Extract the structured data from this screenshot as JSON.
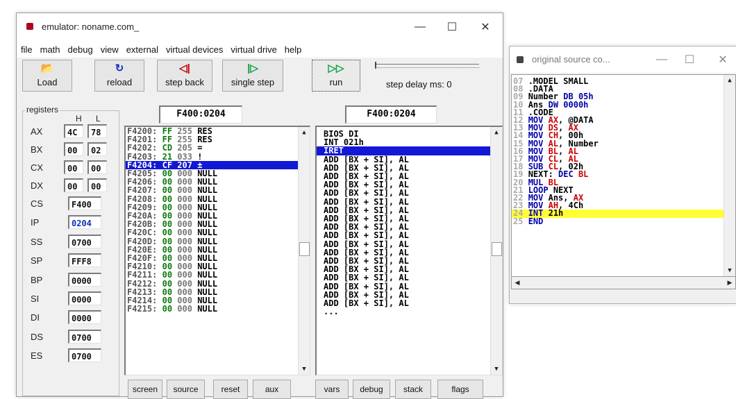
{
  "main_window": {
    "title": "emulator: noname.com_",
    "controls": {
      "minimize": "—",
      "maximize": "☐",
      "close": "✕"
    },
    "menu": [
      "file",
      "math",
      "debug",
      "view",
      "external",
      "virtual devices",
      "virtual drive",
      "help"
    ],
    "toolbar": {
      "load": "Load",
      "reload": "reload",
      "step_back": "step back",
      "single_step": "single step",
      "run": "run",
      "step_delay": "step delay ms: 0"
    },
    "registers": {
      "group_label": "registers",
      "h_header": "H",
      "l_header": "L",
      "pairs": [
        {
          "name": "AX",
          "h": "4C",
          "l": "78"
        },
        {
          "name": "BX",
          "h": "00",
          "l": "02"
        },
        {
          "name": "CX",
          "h": "00",
          "l": "00"
        },
        {
          "name": "DX",
          "h": "00",
          "l": "00"
        }
      ],
      "singles": [
        {
          "name": "CS",
          "value": "F400"
        },
        {
          "name": "IP",
          "value": "0204"
        },
        {
          "name": "SS",
          "value": "0700"
        },
        {
          "name": "SP",
          "value": "FFF8"
        },
        {
          "name": "BP",
          "value": "0000"
        },
        {
          "name": "SI",
          "value": "0000"
        },
        {
          "name": "DI",
          "value": "0000"
        },
        {
          "name": "DS",
          "value": "0700"
        },
        {
          "name": "ES",
          "value": "0700"
        }
      ]
    },
    "memory_address": "F400:0204",
    "disasm_address": "F400:0204",
    "memory_rows": [
      {
        "addr": "F4200:",
        "hex": "FF",
        "dec": "255",
        "chr": "RES"
      },
      {
        "addr": "F4201:",
        "hex": "FF",
        "dec": "255",
        "chr": "RES"
      },
      {
        "addr": "F4202:",
        "hex": "CD",
        "dec": "205",
        "chr": "="
      },
      {
        "addr": "F4203:",
        "hex": "21",
        "dec": "033",
        "chr": "!"
      },
      {
        "addr": "F4204:",
        "hex": "CF",
        "dec": "207",
        "chr": "±"
      },
      {
        "addr": "F4205:",
        "hex": "00",
        "dec": "000",
        "chr": "NULL"
      },
      {
        "addr": "F4206:",
        "hex": "00",
        "dec": "000",
        "chr": "NULL"
      },
      {
        "addr": "F4207:",
        "hex": "00",
        "dec": "000",
        "chr": "NULL"
      },
      {
        "addr": "F4208:",
        "hex": "00",
        "dec": "000",
        "chr": "NULL"
      },
      {
        "addr": "F4209:",
        "hex": "00",
        "dec": "000",
        "chr": "NULL"
      },
      {
        "addr": "F420A:",
        "hex": "00",
        "dec": "000",
        "chr": "NULL"
      },
      {
        "addr": "F420B:",
        "hex": "00",
        "dec": "000",
        "chr": "NULL"
      },
      {
        "addr": "F420C:",
        "hex": "00",
        "dec": "000",
        "chr": "NULL"
      },
      {
        "addr": "F420D:",
        "hex": "00",
        "dec": "000",
        "chr": "NULL"
      },
      {
        "addr": "F420E:",
        "hex": "00",
        "dec": "000",
        "chr": "NULL"
      },
      {
        "addr": "F420F:",
        "hex": "00",
        "dec": "000",
        "chr": "NULL"
      },
      {
        "addr": "F4210:",
        "hex": "00",
        "dec": "000",
        "chr": "NULL"
      },
      {
        "addr": "F4211:",
        "hex": "00",
        "dec": "000",
        "chr": "NULL"
      },
      {
        "addr": "F4212:",
        "hex": "00",
        "dec": "000",
        "chr": "NULL"
      },
      {
        "addr": "F4213:",
        "hex": "00",
        "dec": "000",
        "chr": "NULL"
      },
      {
        "addr": "F4214:",
        "hex": "00",
        "dec": "000",
        "chr": "NULL"
      },
      {
        "addr": "F4215:",
        "hex": "00",
        "dec": "000",
        "chr": "NULL"
      }
    ],
    "memory_selected_index": 4,
    "disasm_rows": [
      "BIOS DI",
      "INT 021h",
      "IRET",
      "ADD [BX + SI], AL",
      "ADD [BX + SI], AL",
      "ADD [BX + SI], AL",
      "ADD [BX + SI], AL",
      "ADD [BX + SI], AL",
      "ADD [BX + SI], AL",
      "ADD [BX + SI], AL",
      "ADD [BX + SI], AL",
      "ADD [BX + SI], AL",
      "ADD [BX + SI], AL",
      "ADD [BX + SI], AL",
      "ADD [BX + SI], AL",
      "ADD [BX + SI], AL",
      "ADD [BX + SI], AL",
      "ADD [BX + SI], AL",
      "ADD [BX + SI], AL",
      "ADD [BX + SI], AL",
      "ADD [BX + SI], AL",
      "..."
    ],
    "disasm_selected_index": 2,
    "bottom_buttons": [
      "screen",
      "source",
      "reset",
      "aux",
      "vars",
      "debug",
      "stack",
      "flags"
    ]
  },
  "source_window": {
    "title": "original source co...",
    "controls": {
      "minimize": "—",
      "maximize": "☐",
      "close": "✕"
    },
    "lines": [
      {
        "n": "07",
        "parts": [
          {
            "t": ".MODEL SMALL",
            "c": "tx"
          }
        ]
      },
      {
        "n": "08",
        "parts": [
          {
            "t": ".DATA",
            "c": "tx"
          }
        ]
      },
      {
        "n": "09",
        "parts": [
          {
            "t": "Number ",
            "c": "tx"
          },
          {
            "t": "DB 05h",
            "c": "kw"
          }
        ]
      },
      {
        "n": "10",
        "parts": [
          {
            "t": "Ans ",
            "c": "tx"
          },
          {
            "t": "DW 0000h",
            "c": "kw"
          }
        ]
      },
      {
        "n": "11",
        "parts": [
          {
            "t": ".CODE",
            "c": "tx"
          }
        ]
      },
      {
        "n": "12",
        "parts": [
          {
            "t": "MOV ",
            "c": "kw"
          },
          {
            "t": "AX",
            "c": "rg"
          },
          {
            "t": ", @DATA",
            "c": "tx"
          }
        ]
      },
      {
        "n": "13",
        "parts": [
          {
            "t": "MOV ",
            "c": "kw"
          },
          {
            "t": "DS",
            "c": "rg"
          },
          {
            "t": ", ",
            "c": "tx"
          },
          {
            "t": "AX",
            "c": "rg"
          }
        ]
      },
      {
        "n": "14",
        "parts": [
          {
            "t": "MOV ",
            "c": "kw"
          },
          {
            "t": "CH",
            "c": "rg"
          },
          {
            "t": ", 00h",
            "c": "tx"
          }
        ]
      },
      {
        "n": "15",
        "parts": [
          {
            "t": "MOV ",
            "c": "kw"
          },
          {
            "t": "AL",
            "c": "rg"
          },
          {
            "t": ", Number",
            "c": "tx"
          }
        ]
      },
      {
        "n": "16",
        "parts": [
          {
            "t": "MOV ",
            "c": "kw"
          },
          {
            "t": "BL",
            "c": "rg"
          },
          {
            "t": ", ",
            "c": "tx"
          },
          {
            "t": "AL",
            "c": "rg"
          }
        ]
      },
      {
        "n": "17",
        "parts": [
          {
            "t": "MOV ",
            "c": "kw"
          },
          {
            "t": "CL",
            "c": "rg"
          },
          {
            "t": ", ",
            "c": "tx"
          },
          {
            "t": "AL",
            "c": "rg"
          }
        ]
      },
      {
        "n": "18",
        "parts": [
          {
            "t": "SUB ",
            "c": "kw"
          },
          {
            "t": "CL",
            "c": "rg"
          },
          {
            "t": ", 02h",
            "c": "tx"
          }
        ]
      },
      {
        "n": "19",
        "parts": [
          {
            "t": "NEXT: ",
            "c": "tx"
          },
          {
            "t": "DEC ",
            "c": "kw"
          },
          {
            "t": "BL",
            "c": "rg"
          }
        ]
      },
      {
        "n": "20",
        "parts": [
          {
            "t": "MUL ",
            "c": "kw"
          },
          {
            "t": "BL",
            "c": "rg"
          }
        ]
      },
      {
        "n": "21",
        "parts": [
          {
            "t": "LOOP ",
            "c": "kw"
          },
          {
            "t": "NEXT",
            "c": "tx"
          }
        ]
      },
      {
        "n": "22",
        "parts": [
          {
            "t": "MOV ",
            "c": "kw"
          },
          {
            "t": "Ans, ",
            "c": "tx"
          },
          {
            "t": "AX",
            "c": "rg"
          }
        ]
      },
      {
        "n": "23",
        "parts": [
          {
            "t": "MOV ",
            "c": "kw"
          },
          {
            "t": "AH",
            "c": "rg"
          },
          {
            "t": ", 4Ch",
            "c": "tx"
          }
        ]
      },
      {
        "n": "24",
        "parts": [
          {
            "t": "INT ",
            "c": "kw"
          },
          {
            "t": "21h",
            "c": "tx"
          }
        ]
      },
      {
        "n": "25",
        "parts": [
          {
            "t": "END",
            "c": "kw"
          }
        ]
      }
    ],
    "highlight_index": 17
  },
  "colors": {
    "selection": "#1218d6",
    "source_highlight": "#ffff33",
    "keyword": "#0000aa",
    "register": "#cc0000",
    "memory_value": "#0a7a0a"
  }
}
